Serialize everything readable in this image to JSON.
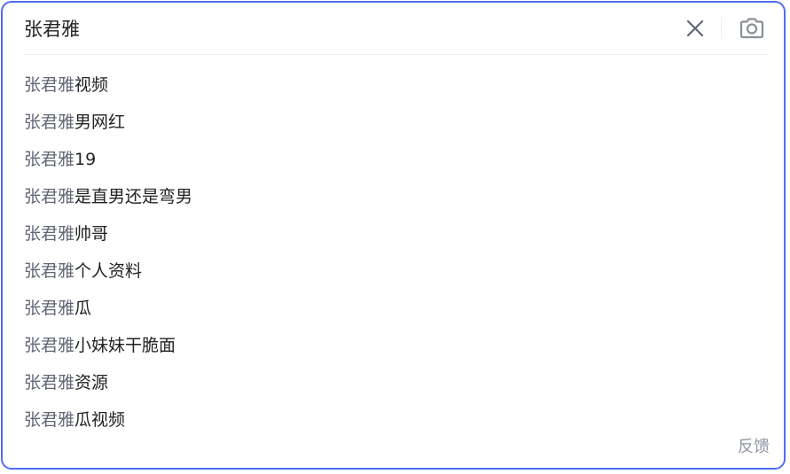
{
  "search": {
    "value": "张君雅",
    "clear_icon": "close-icon",
    "camera_icon": "camera-icon"
  },
  "suggestions": [
    {
      "query": "张君雅",
      "rest": "视频"
    },
    {
      "query": "张君雅",
      "rest": "男网红"
    },
    {
      "query": "张君雅",
      "rest": "19"
    },
    {
      "query": "张君雅",
      "rest": "是直男还是弯男"
    },
    {
      "query": "张君雅",
      "rest": "帅哥"
    },
    {
      "query": "张君雅",
      "rest": "个人资料"
    },
    {
      "query": "张君雅",
      "rest": "瓜"
    },
    {
      "query": "张君雅",
      "rest": "小妹妹干脆面"
    },
    {
      "query": "张君雅",
      "rest": "资源"
    },
    {
      "query": "张君雅",
      "rest": "瓜视频"
    }
  ],
  "footer": {
    "feedback_label": "反馈"
  },
  "colors": {
    "border": "#4e6ef2",
    "query_text": "#626675",
    "suggestion_text": "#222222",
    "feedback_text": "#9195a3"
  }
}
